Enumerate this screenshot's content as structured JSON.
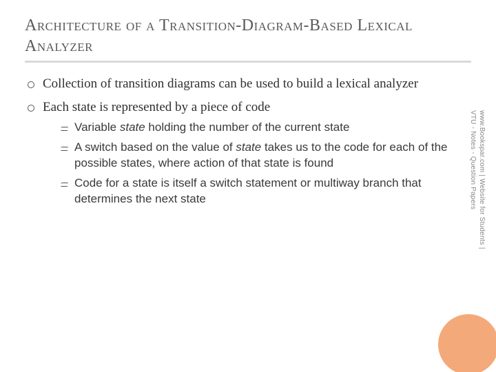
{
  "title": "Architecture of a Transition-Diagram-Based Lexical Analyzer",
  "bullets": {
    "b1": "Collection of transition diagrams can be used to build a lexical analyzer",
    "b2": "Each state is represented by a piece of code"
  },
  "sub": {
    "s1_pre": "Variable ",
    "s1_it": "state",
    "s1_post": " holding the number of the current state",
    "s2_pre": "A switch based on the value of ",
    "s2_it": "state",
    "s2_post": " takes us to the code for each of the possible states, where action of that state is found",
    "s3": "Code for a state is itself a switch statement or multiway branch that determines the next state"
  },
  "side": {
    "line1": "www.Bookspar.com | Website for Students |",
    "line2": "VTU - Notes - Question Papers"
  }
}
